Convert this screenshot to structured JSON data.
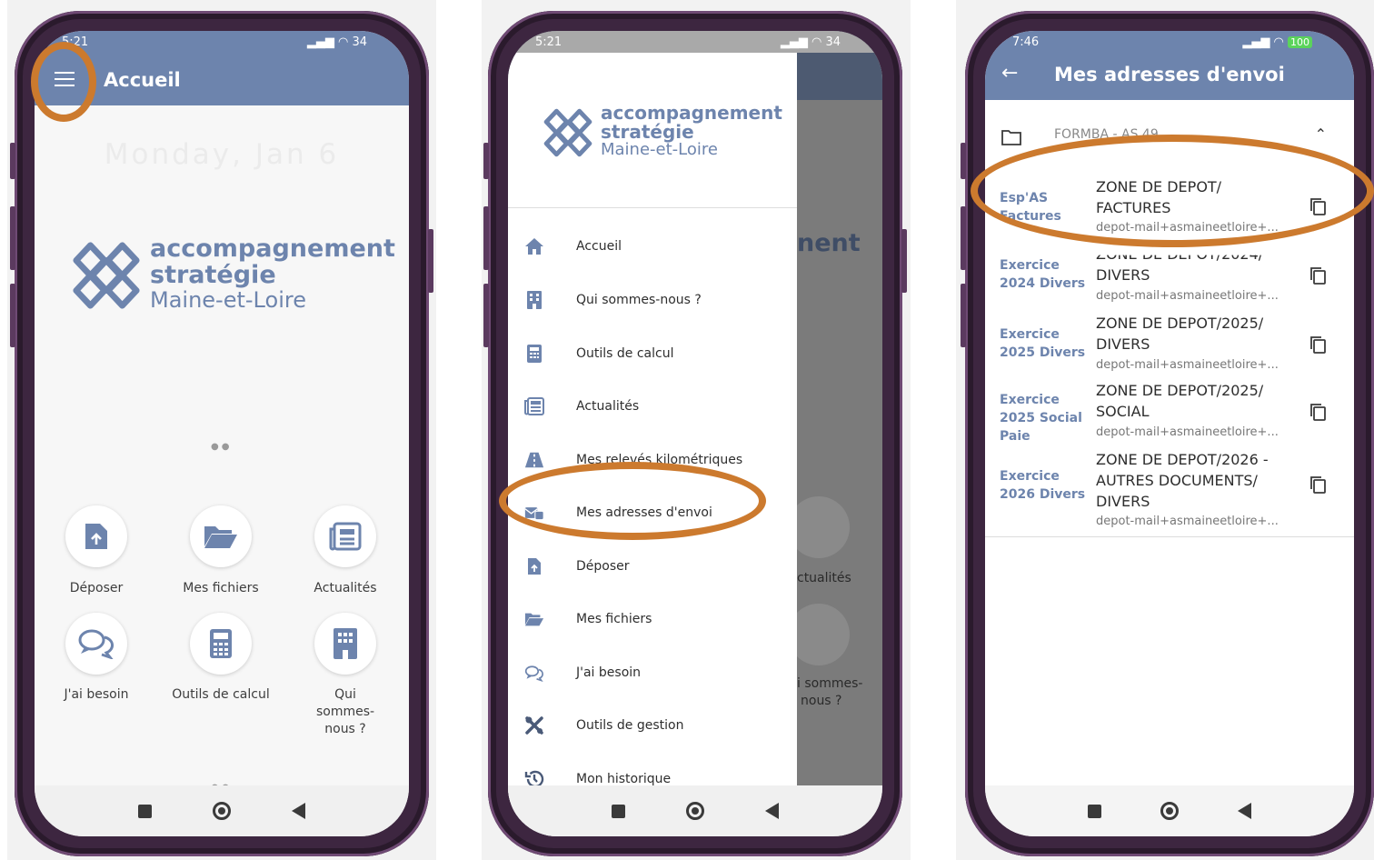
{
  "colors": {
    "accent": "#6d84ad",
    "highlight": "#cc7a2e",
    "phone_frame": "#3d2640"
  },
  "screen1": {
    "status_time": "5:21",
    "status_battery": "34",
    "title": "Accueil",
    "date": "Monday, Jan 6",
    "logo": {
      "line1": "accompagnement",
      "line2": "stratégie",
      "line3": "Maine-et-Loire"
    },
    "shortcuts": [
      {
        "label": "Déposer",
        "icon": "upload-file-icon"
      },
      {
        "label": "Mes fichiers",
        "icon": "folder-open-icon"
      },
      {
        "label": "Actualités",
        "icon": "newspaper-icon"
      },
      {
        "label": "J'ai besoin",
        "icon": "chat-bubbles-icon"
      },
      {
        "label": "Outils de calcul",
        "icon": "calculator-icon"
      },
      {
        "label": "Qui sommes-nous ?",
        "icon": "building-icon"
      }
    ]
  },
  "screen2": {
    "status_time": "5:21",
    "status_battery": "34",
    "logo": {
      "line1": "accompagnement",
      "line2": "stratégie",
      "line3": "Maine-et-Loire"
    },
    "menu": [
      {
        "label": "Accueil",
        "icon": "home-icon"
      },
      {
        "label": "Qui sommes-nous ?",
        "icon": "building-icon"
      },
      {
        "label": "Outils de calcul",
        "icon": "calculator-icon"
      },
      {
        "label": "Actualités",
        "icon": "newspaper-icon"
      },
      {
        "label": "Mes relevés kilométriques",
        "icon": "road-icon"
      },
      {
        "label": "Mes adresses d'envoi",
        "icon": "mail-address-icon"
      },
      {
        "label": "Déposer",
        "icon": "upload-file-icon"
      },
      {
        "label": "Mes fichiers",
        "icon": "folder-open-icon"
      },
      {
        "label": "J'ai besoin",
        "icon": "chat-bubbles-icon"
      },
      {
        "label": "Outils de gestion",
        "icon": "tools-icon"
      },
      {
        "label": "Mon historique",
        "icon": "history-icon"
      }
    ],
    "behind": {
      "title_fragment": "nent",
      "actualites": "ctualités",
      "qui1": "i sommes-",
      "qui2": "nous ?"
    }
  },
  "screen3": {
    "status_time": "7:46",
    "status_battery": "100",
    "title": "Mes adresses d'envoi",
    "folder_name": "FORMBA - AS 49",
    "rows": [
      {
        "left": [
          "Esp'AS",
          "Factures"
        ],
        "zone": [
          "ZONE DE DEPOT/",
          "FACTURES"
        ],
        "mail": "depot-mail+asmaineetloire+..."
      },
      {
        "left": [
          "Exercice",
          "2024 Divers"
        ],
        "zone": [
          "ZONE DE DEPOT/2024/",
          "DIVERS"
        ],
        "mail": "depot-mail+asmaineetloire+..."
      },
      {
        "left": [
          "Exercice",
          "2025 Divers"
        ],
        "zone": [
          "ZONE DE DEPOT/2025/",
          "DIVERS"
        ],
        "mail": "depot-mail+asmaineetloire+..."
      },
      {
        "left": [
          "Exercice",
          "2025 Social",
          "Paie"
        ],
        "zone": [
          "ZONE DE DEPOT/2025/",
          "SOCIAL"
        ],
        "mail": "depot-mail+asmaineetloire+..."
      },
      {
        "left": [
          "Exercice",
          "2026 Divers"
        ],
        "zone": [
          "ZONE DE DEPOT/2026 -",
          "AUTRES DOCUMENTS/",
          "DIVERS"
        ],
        "mail": "depot-mail+asmaineetloire+..."
      }
    ]
  }
}
